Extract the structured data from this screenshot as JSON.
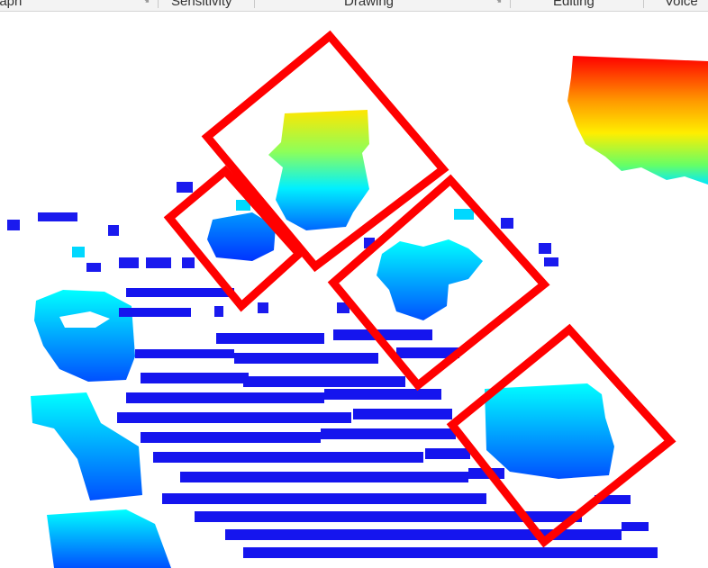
{
  "ribbon": {
    "groups": [
      {
        "label": "graph",
        "has_launcher": true
      },
      {
        "label": "Sensitivity",
        "has_launcher": false
      },
      {
        "label": "Drawing",
        "has_launcher": true
      },
      {
        "label": "Editing",
        "has_launcher": false
      },
      {
        "label": "Voice",
        "has_launcher": false
      }
    ],
    "launcher_icon": "dialog-launcher-icon"
  },
  "canvas": {
    "content": "depth-heatmap-image",
    "annotations": {
      "box_count": 4,
      "color": "#ff0000",
      "style": "rotated rectangle outlines"
    },
    "colors": {
      "near": "#ff0000",
      "mid": "#00ffff",
      "far": "#0000ff"
    }
  }
}
